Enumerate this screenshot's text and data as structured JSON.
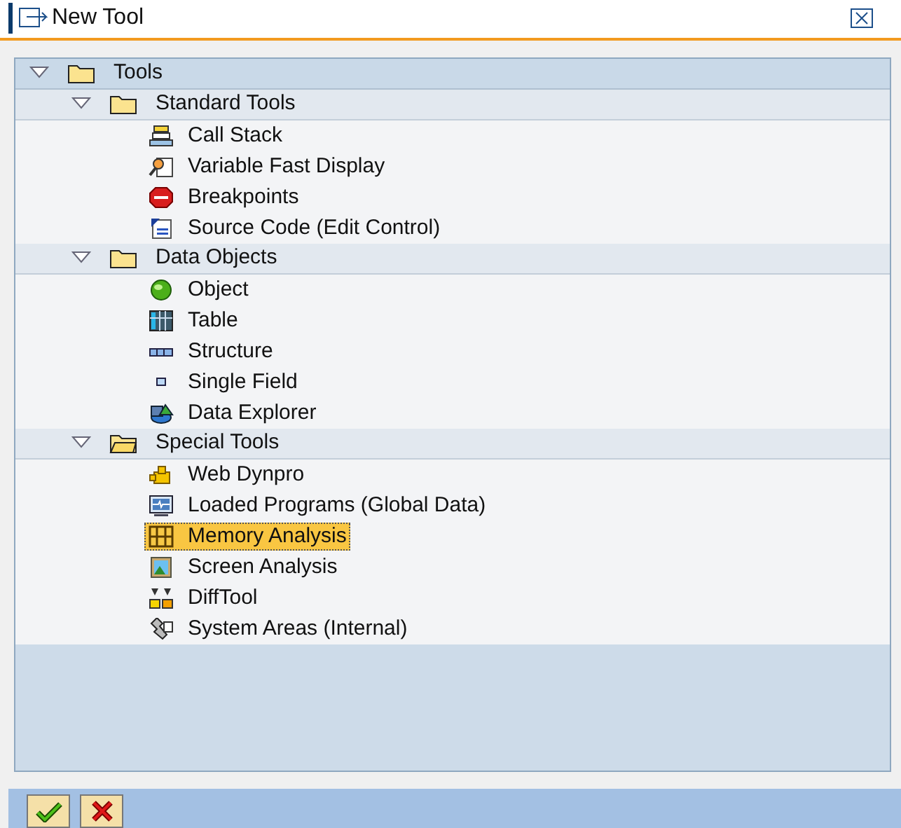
{
  "window": {
    "title": "New Tool"
  },
  "tree": [
    {
      "label": "Tools",
      "expanded": true,
      "children": [
        {
          "label": "Standard Tools",
          "expanded": true,
          "children": [
            {
              "label": "Call Stack",
              "selected": false
            },
            {
              "label": "Variable Fast Display",
              "selected": false
            },
            {
              "label": "Breakpoints",
              "selected": false
            },
            {
              "label": "Source Code (Edit Control)",
              "selected": false
            }
          ]
        },
        {
          "label": "Data Objects",
          "expanded": true,
          "children": [
            {
              "label": "Object",
              "selected": false
            },
            {
              "label": "Table",
              "selected": false
            },
            {
              "label": "Structure",
              "selected": false
            },
            {
              "label": "Single Field",
              "selected": false
            },
            {
              "label": "Data Explorer",
              "selected": false
            }
          ]
        },
        {
          "label": "Special Tools",
          "expanded": true,
          "children": [
            {
              "label": "Web Dynpro",
              "selected": false
            },
            {
              "label": "Loaded Programs (Global Data)",
              "selected": false
            },
            {
              "label": "Memory Analysis",
              "selected": true
            },
            {
              "label": "Screen Analysis",
              "selected": false
            },
            {
              "label": "DiffTool",
              "selected": false
            },
            {
              "label": "System Areas (Internal)",
              "selected": false
            }
          ]
        }
      ]
    }
  ]
}
